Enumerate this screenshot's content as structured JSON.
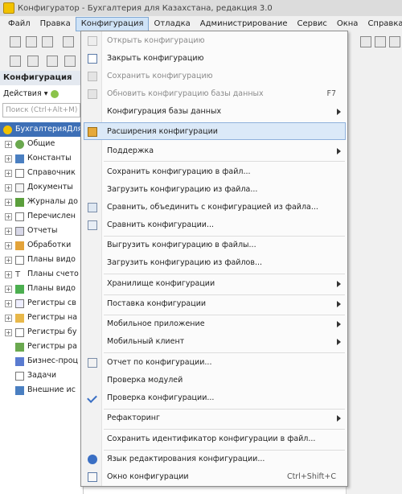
{
  "window": {
    "title": "Конфигуратор - Бухгалтерия для Казахстана, редакция 3.0"
  },
  "menubar": [
    "Файл",
    "Правка",
    "Конфигурация",
    "Отладка",
    "Администрирование",
    "Сервис",
    "Окна",
    "Справка"
  ],
  "left_panel": {
    "header": "Конфигурация",
    "actions_label": "Действия ▾",
    "search_placeholder": "Поиск (Ctrl+Alt+M)",
    "root": "БухгалтерияДля",
    "tree": [
      "Общие",
      "Константы",
      "Справочник",
      "Документы",
      "Журналы до",
      "Перечислен",
      "Отчеты",
      "Обработки",
      "Планы видо",
      "Планы счето",
      "Планы видо",
      "Регистры св",
      "Регистры на",
      "Регистры бу",
      "Регистры ра",
      "Бизнес-проц",
      "Задачи",
      "Внешние ис"
    ]
  },
  "menu": {
    "items": [
      {
        "label": "Открыть конфигурацию",
        "disabled": true,
        "icon": "open-config-icon"
      },
      {
        "label": "Закрыть конфигурацию",
        "disabled": false,
        "icon": "close-config-icon"
      },
      {
        "label": "Сохранить конфигурацию",
        "disabled": true,
        "icon": "save-config-icon"
      },
      {
        "label": "Обновить конфигурацию базы данных",
        "disabled": true,
        "shortcut": "F7",
        "icon": "update-db-icon"
      },
      {
        "label": "Конфигурация базы данных",
        "submenu": true
      },
      {
        "label": "Расширения конфигурации",
        "highlighted": true,
        "icon": "extensions-icon"
      },
      {
        "label": "Поддержка",
        "submenu": true
      },
      {
        "label": "Сохранить конфигурацию в файл..."
      },
      {
        "label": "Загрузить конфигурацию из файла..."
      },
      {
        "label": "Сравнить, объединить с конфигурацией из файла...",
        "icon": "compare-merge-icon"
      },
      {
        "label": "Сравнить конфигурации...",
        "icon": "compare-icon"
      },
      {
        "label": "Выгрузить конфигурацию в файлы..."
      },
      {
        "label": "Загрузить конфигурацию из файлов..."
      },
      {
        "label": "Хранилище конфигурации",
        "submenu": true
      },
      {
        "label": "Поставка конфигурации",
        "submenu": true
      },
      {
        "label": "Мобильное приложение",
        "submenu": true
      },
      {
        "label": "Мобильный клиент",
        "submenu": true
      },
      {
        "label": "Отчет по конфигурации...",
        "icon": "report-icon"
      },
      {
        "label": "Проверка модулей"
      },
      {
        "label": "Проверка конфигурации...",
        "icon": "check-icon"
      },
      {
        "label": "Рефакторинг",
        "submenu": true
      },
      {
        "label": "Сохранить идентификатор конфигурации в файл..."
      },
      {
        "label": "Язык редактирования конфигурации...",
        "icon": "language-icon"
      },
      {
        "label": "Окно конфигурации",
        "shortcut": "Ctrl+Shift+C",
        "icon": "config-window-icon"
      }
    ]
  },
  "colors": {
    "highlight": "#dbe9f8",
    "tree_selected": "#3d6fb6",
    "disabled": "#8a8a8a"
  }
}
